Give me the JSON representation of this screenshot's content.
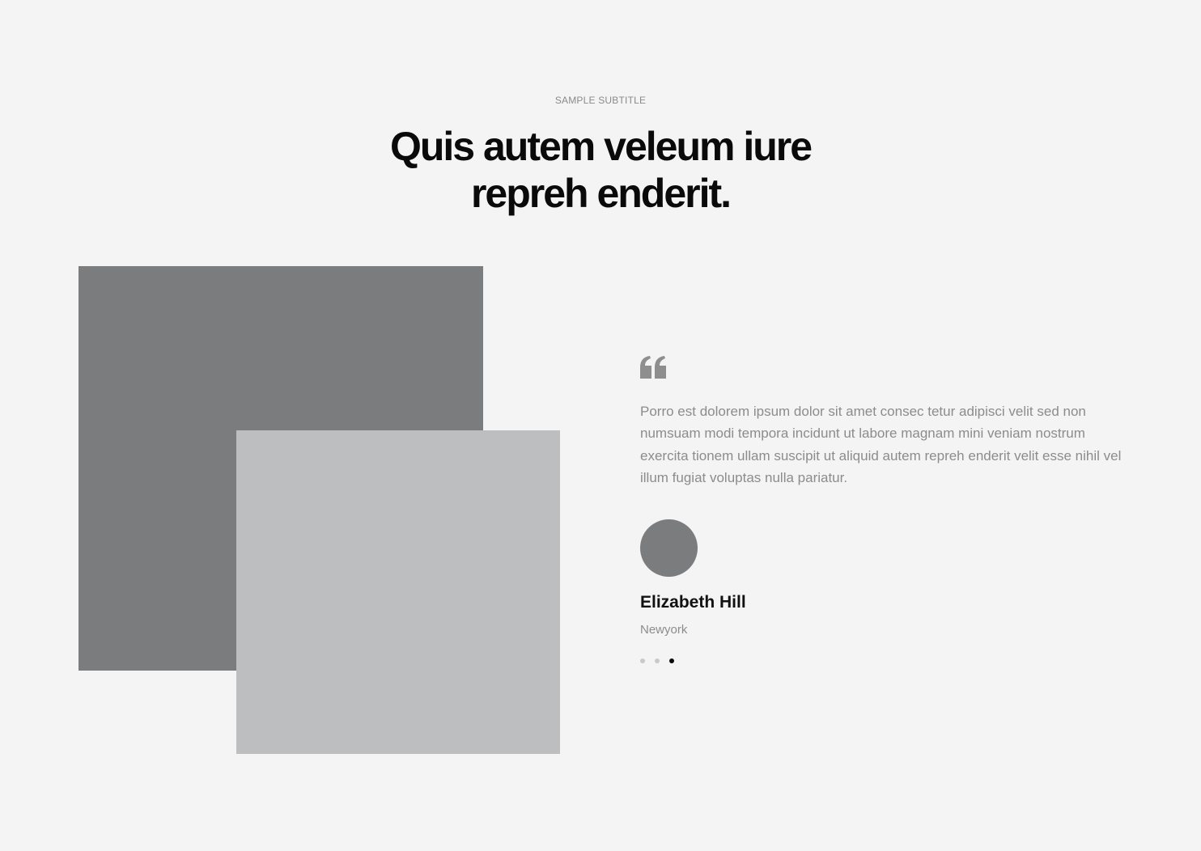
{
  "header": {
    "subtitle": "SAMPLE SUBTITLE",
    "title_line1": "Quis autem veleum iure",
    "title_line2": "repreh enderit."
  },
  "testimonial": {
    "quote_icon": "quote-icon",
    "text": "Porro est dolorem ipsum dolor sit amet consec tetur adipisci velit sed non numsuam modi tempora incidunt ut labore magnam mini veniam nostrum exercita tionem ullam suscipit ut aliquid autem repreh enderit velit esse nihil vel illum fugiat voluptas nulla pariatur.",
    "author": {
      "name": "Elizabeth Hill",
      "location": "Newyork"
    },
    "slider": {
      "total": 3,
      "active_index": 2
    }
  },
  "colors": {
    "background": "#f4f4f4",
    "image_dark": "#7b7c7e",
    "image_light": "#bdbebf",
    "text_muted": "#8c8c8c",
    "heading": "#0a0a0a"
  }
}
